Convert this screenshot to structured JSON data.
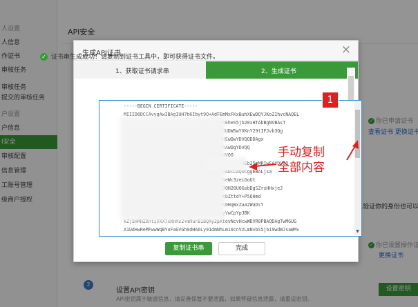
{
  "sidebar": {
    "items": [
      {
        "label": "人设置",
        "style": "group"
      },
      {
        "label": "人信息",
        "style": ""
      },
      {
        "label": "作证书",
        "style": ""
      },
      {
        "label": "审核任务",
        "style": ""
      },
      {
        "label": "审核任务",
        "style": ""
      },
      {
        "label": "提交的审核任务",
        "style": ""
      },
      {
        "label": "户设置",
        "style": "group"
      },
      {
        "label": "户信息",
        "style": ""
      },
      {
        "label": "I安全",
        "style": "active"
      },
      {
        "label": "审核配置",
        "style": ""
      },
      {
        "label": "信息管理",
        "style": ""
      },
      {
        "label": "工账号管理",
        "style": ""
      },
      {
        "label": "级商户授权",
        "style": ""
      }
    ]
  },
  "page": {
    "title": "API安全",
    "right_status_1": "你已申请证书",
    "right_link_1a": "查看证书",
    "right_link_1b": "更换证书",
    "right_text_2": "以验证你的身份也可以防",
    "right_status_3": "你已设置操作证",
    "right_link_3": "更换证书"
  },
  "modal": {
    "title": "生成API证书",
    "close": "×",
    "step1": "1、获取证书请求串",
    "step2": "2、生成证书",
    "success": "证书串生成成功！请复制到证书工具中，即可获得证书文件。",
    "cert_lines": [
      "-----BEGIN CERTIFICATE-----",
      "MIIID6DCCAvygAwIBAgIUH7b6Ibyt9Q+AdFEmMxFKxBuhXEwDQYJKoZIhvcNAQEL",
      "                             T9C1R1bnEheS5jb20xHTAbBgNVBAsT",
      "                             DVQQDEzJUDW5wYXKnY29tIFJvb3Qg",
      "                             7EWjE2MHEwDwYDVQQDDAgx",
      "                             9757ufMRAwDgYDVQQ",
      "                             MrAwDgVHVQ0",
      "                             J1URCAwJK3VhbmdEb25nMRIwEAYDVQQ",
      "                             DQADggEPADCCAQoCggEBALjsa",
      "                             3jm6e1nSeWc3zeiGoUt",
      "                             C5QEQWPDQH20U0GsbDgSZrsHHxjeJ",
      "                             Gxgmh4MmbZttdY+P5Q0md",
      "x                            UPGBSQwK0HqWxZaa2WaDsY",
      "TqaW                         fUogJEiyVwCpYpJBK",
      "kZj5HMHZXntiVXX7xMnMz2+mMurB18QXy2pXtevNcvHcwWDVR0PBAQDAgTwMGUG",
      "A1UdHwReMFwwWqBYoFaGVGh0dHA6Ly91dmNhLm10cnVzLmNvbS5jbi9wdWJsaWMv"
    ],
    "copy_button": "复制证书串",
    "done_button": "完成"
  },
  "annotation": {
    "badge": "1",
    "line1": "手动复制",
    "line2": "全部内容",
    "color": "#e02020"
  },
  "bottom": {
    "step_num": "2",
    "title": "设置API密钥",
    "desc": "API密钥属于敏感信息，请妥善保管不要泄露，如果怀疑信息泄露，请重设密钥。",
    "button": "设置密钥"
  },
  "colors": {
    "accent": "#3a9a3a",
    "link": "#2a6fc9"
  }
}
